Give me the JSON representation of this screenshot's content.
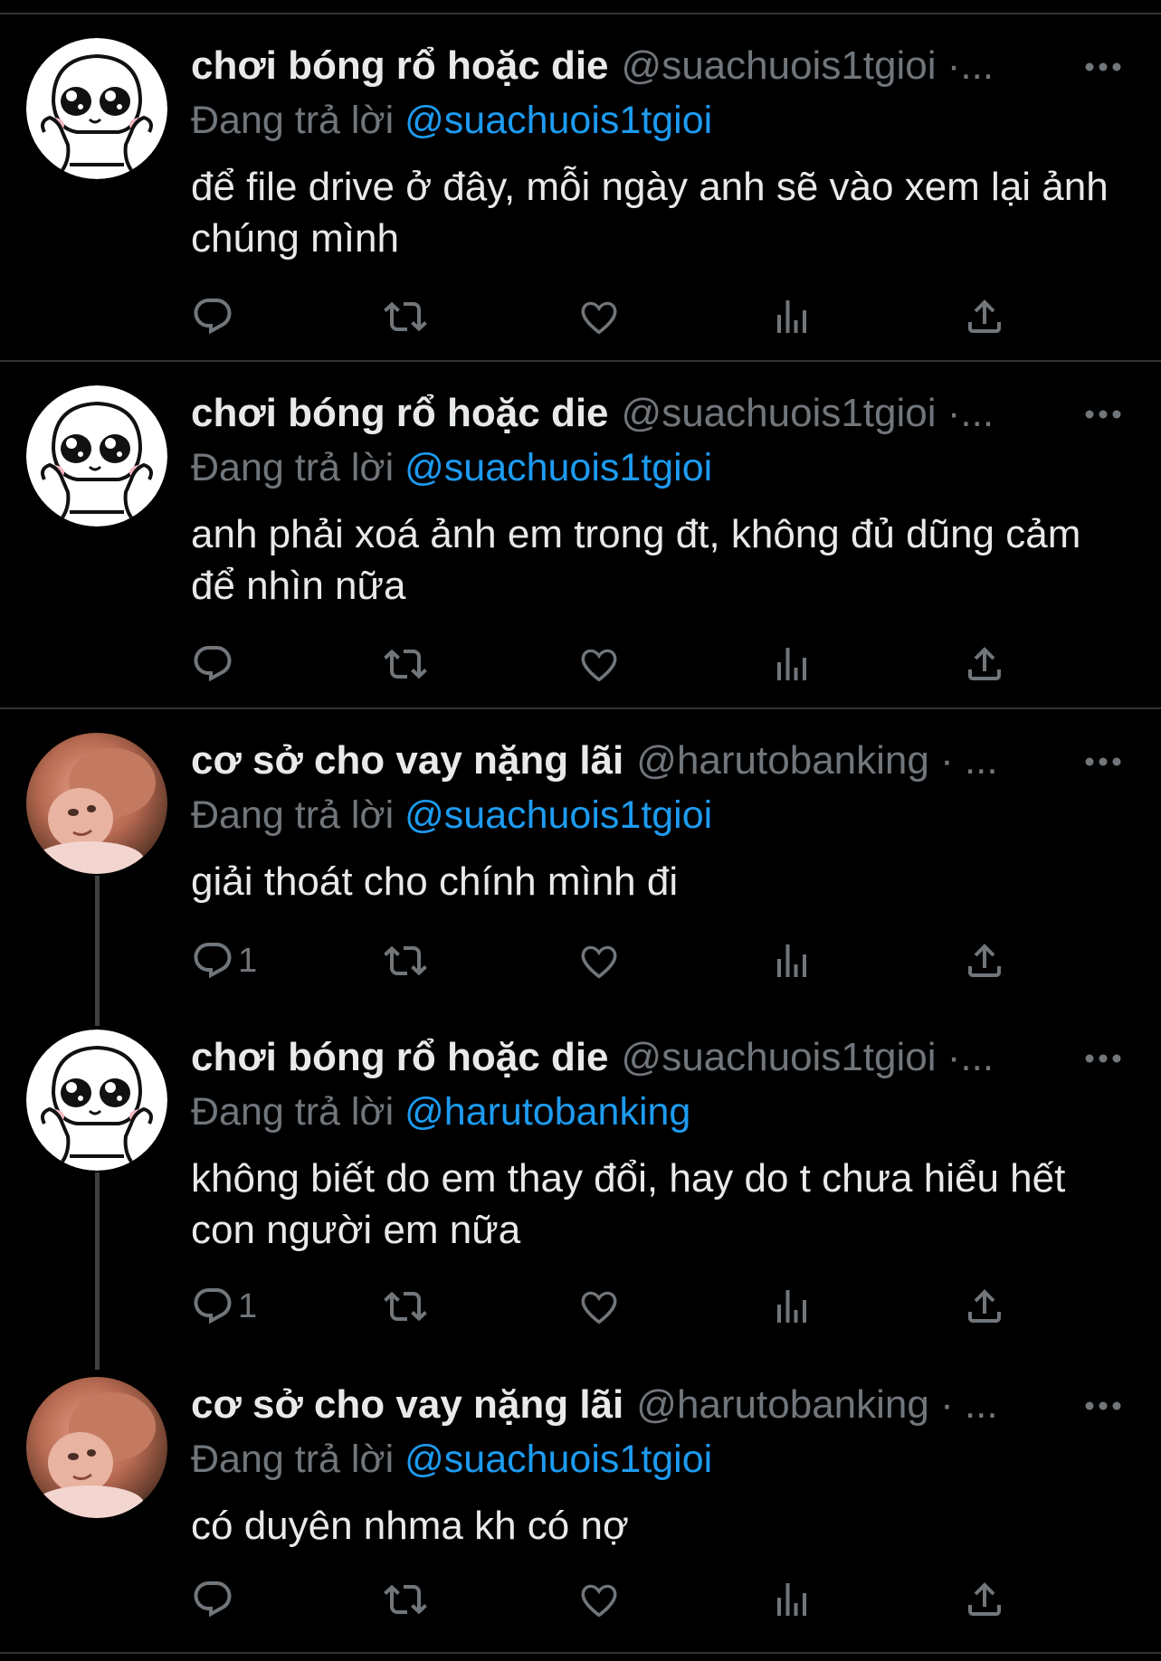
{
  "colors": {
    "background": "#000000",
    "text": "#e7e9ea",
    "muted": "#71767b",
    "link": "#1d9bf0",
    "divider": "#2f3336"
  },
  "tweets": [
    {
      "name": "chơi bóng rổ hoặc die",
      "handle": "@suachuois1tgioi",
      "ellipsis": " ·...",
      "reply_prefix": "Đang trả lời ",
      "reply_to": "@suachuois1tgioi",
      "text": "để file drive ở đây, mỗi ngày anh sẽ vào xem lại ảnh chúng mình",
      "reply_count": "",
      "avatar": "cartoon-avatar"
    },
    {
      "name": "chơi bóng rổ hoặc die",
      "handle": "@suachuois1tgioi",
      "ellipsis": " ·...",
      "reply_prefix": "Đang trả lời ",
      "reply_to": "@suachuois1tgioi",
      "text": "anh phải xoá ảnh em trong đt, không đủ dũng cảm để nhìn nữa",
      "reply_count": "",
      "avatar": "cartoon-avatar"
    },
    {
      "name": "cơ sở cho vay nặng lãi",
      "handle": "@harutobanking",
      "ellipsis": " · ...",
      "reply_prefix": "Đang trả lời ",
      "reply_to": "@suachuois1tgioi",
      "text": "giải thoát cho chính mình đi",
      "reply_count": "1",
      "avatar": "photo-avatar"
    },
    {
      "name": "chơi bóng rổ hoặc die",
      "handle": "@suachuois1tgioi",
      "ellipsis": " ·...",
      "reply_prefix": "Đang trả lời ",
      "reply_to": "@harutobanking",
      "text": "không biết do em thay đổi, hay do t chưa hiểu hết con người em nữa",
      "reply_count": "1",
      "avatar": "cartoon-avatar"
    },
    {
      "name": "cơ sở cho vay nặng lãi",
      "handle": "@harutobanking",
      "ellipsis": " · ...",
      "reply_prefix": "Đang trả lời ",
      "reply_to": "@suachuois1tgioi",
      "text": "có duyên nhma kh có nợ",
      "reply_count": "",
      "avatar": "photo-avatar"
    }
  ],
  "icons": {
    "reply": "reply-icon",
    "retweet": "retweet-icon",
    "like": "heart-icon",
    "views": "views-icon",
    "share": "share-icon",
    "more": "more-options-icon"
  }
}
